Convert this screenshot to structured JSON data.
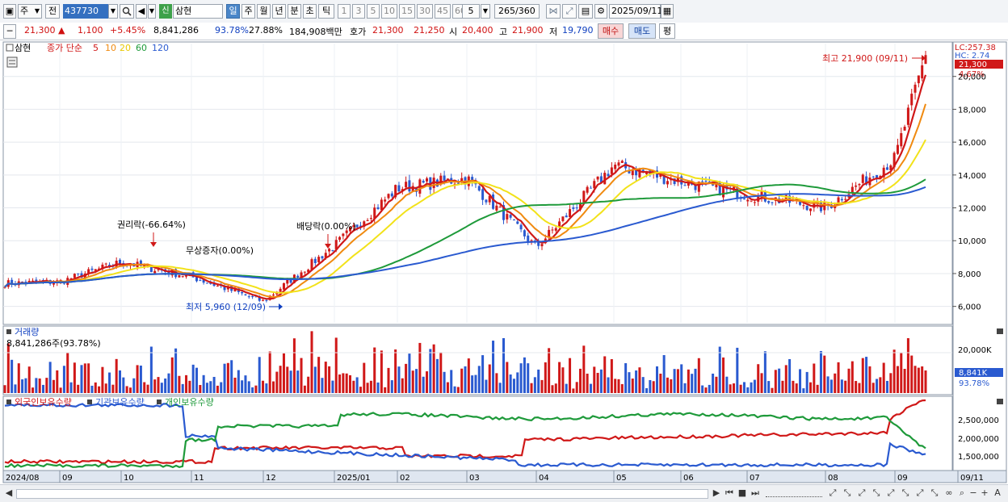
{
  "toolbar": {
    "type_label": "주",
    "market_label": "전",
    "code": "437730",
    "search_icon": "search-icon",
    "shin_label": "신",
    "name": "삼현",
    "periods": [
      "일",
      "주",
      "월",
      "년",
      "분",
      "초",
      "틱"
    ],
    "active_period": "일",
    "intervals": [
      "1",
      "3",
      "5",
      "10",
      "15",
      "30",
      "45",
      "60"
    ],
    "interval_value": "5",
    "count": "265",
    "count_total": "/360",
    "date": "2025/09/11"
  },
  "info": {
    "price": "21,300",
    "change": "1,100",
    "change_pct": "+5.45%",
    "volume": "8,841,286",
    "vol_ratio": "93.78%",
    "turnover": "27.88%",
    "amount": "184,908백만",
    "quote_label": "호가",
    "quote_ask": "21,300",
    "quote_bid": "21,250",
    "open_label": "시",
    "open": "20,400",
    "high_label": "고",
    "high": "21,900",
    "low_label": "저",
    "low": "19,790",
    "buy_label": "매수",
    "sell_label": "매도",
    "eval_label": "평"
  },
  "price_panel": {
    "stock_name": "삼현",
    "ma_label": "종가 단순",
    "ma_periods": [
      "5",
      "10",
      "20",
      "60",
      "120"
    ],
    "ma_colors": [
      "#d01818",
      "#f08a10",
      "#f2e21a",
      "#1e9a3a",
      "#2a5ad0"
    ],
    "lc_label": "LC:257.38",
    "hc_label": "HC: 2.74",
    "last_price_label": "21,300",
    "last_pct_label": "4.67%",
    "y_ticks": [
      "20,000",
      "18,000",
      "16,000",
      "14,000",
      "12,000",
      "10,000",
      "8,000",
      "6,000"
    ],
    "annotations": {
      "high": "최고 21,900 (09/11)",
      "low": "최저 5,960 (12/09)",
      "rights": "권리락(-66.64%)",
      "bonus": "무상증자(0.00%)",
      "dividend": "배당락(0.00%)"
    }
  },
  "volume_panel": {
    "title": "거래량",
    "value": "8,841,286주(93.78%)",
    "y_tick": "20,000K",
    "last_label": "8,841K",
    "last_pct": "93.78%"
  },
  "holding_panel": {
    "legend": [
      "외국인보유수량",
      "기관보유수량",
      "개인보유수량"
    ],
    "legend_colors": [
      "#d01818",
      "#2a5ad0",
      "#1e9a3a"
    ],
    "y_ticks": [
      "2,500,000",
      "2,000,000",
      "1,500,000"
    ]
  },
  "x_axis": {
    "labels": [
      "2024/08",
      "09",
      "10",
      "11",
      "12",
      "2025/01",
      "02",
      "03",
      "04",
      "05",
      "06",
      "07",
      "08",
      "09",
      "09/11"
    ]
  },
  "chart_data": {
    "type": "candlestick",
    "title": "",
    "symbol": "삼현 (437730)",
    "price_axis": {
      "min": 5000,
      "max": 22000,
      "ticks": [
        6000,
        8000,
        10000,
        12000,
        14000,
        16000,
        18000,
        20000
      ]
    },
    "price_series": [
      {
        "date": "2024/08",
        "close": 7400
      },
      {
        "date": "2024/09",
        "close": 7500
      },
      {
        "date": "2024/10",
        "close": 8700
      },
      {
        "date": "2024/11",
        "close": 7800
      },
      {
        "date": "2024/12",
        "close": 6300
      },
      {
        "date": "2025/01",
        "close": 9700
      },
      {
        "date": "2025/02",
        "close": 13200
      },
      {
        "date": "2025/03",
        "close": 13800
      },
      {
        "date": "2025/04",
        "close": 9600
      },
      {
        "date": "2025/05",
        "close": 14600
      },
      {
        "date": "2025/06",
        "close": 13600
      },
      {
        "date": "2025/07",
        "close": 12800
      },
      {
        "date": "2025/08",
        "close": 12000
      },
      {
        "date": "2025/09",
        "close": 15000
      },
      {
        "date": "2025/09/11",
        "close": 21300
      }
    ],
    "volume_axis": {
      "ticks": [
        20000
      ]
    },
    "volume_unit": "K"
  }
}
